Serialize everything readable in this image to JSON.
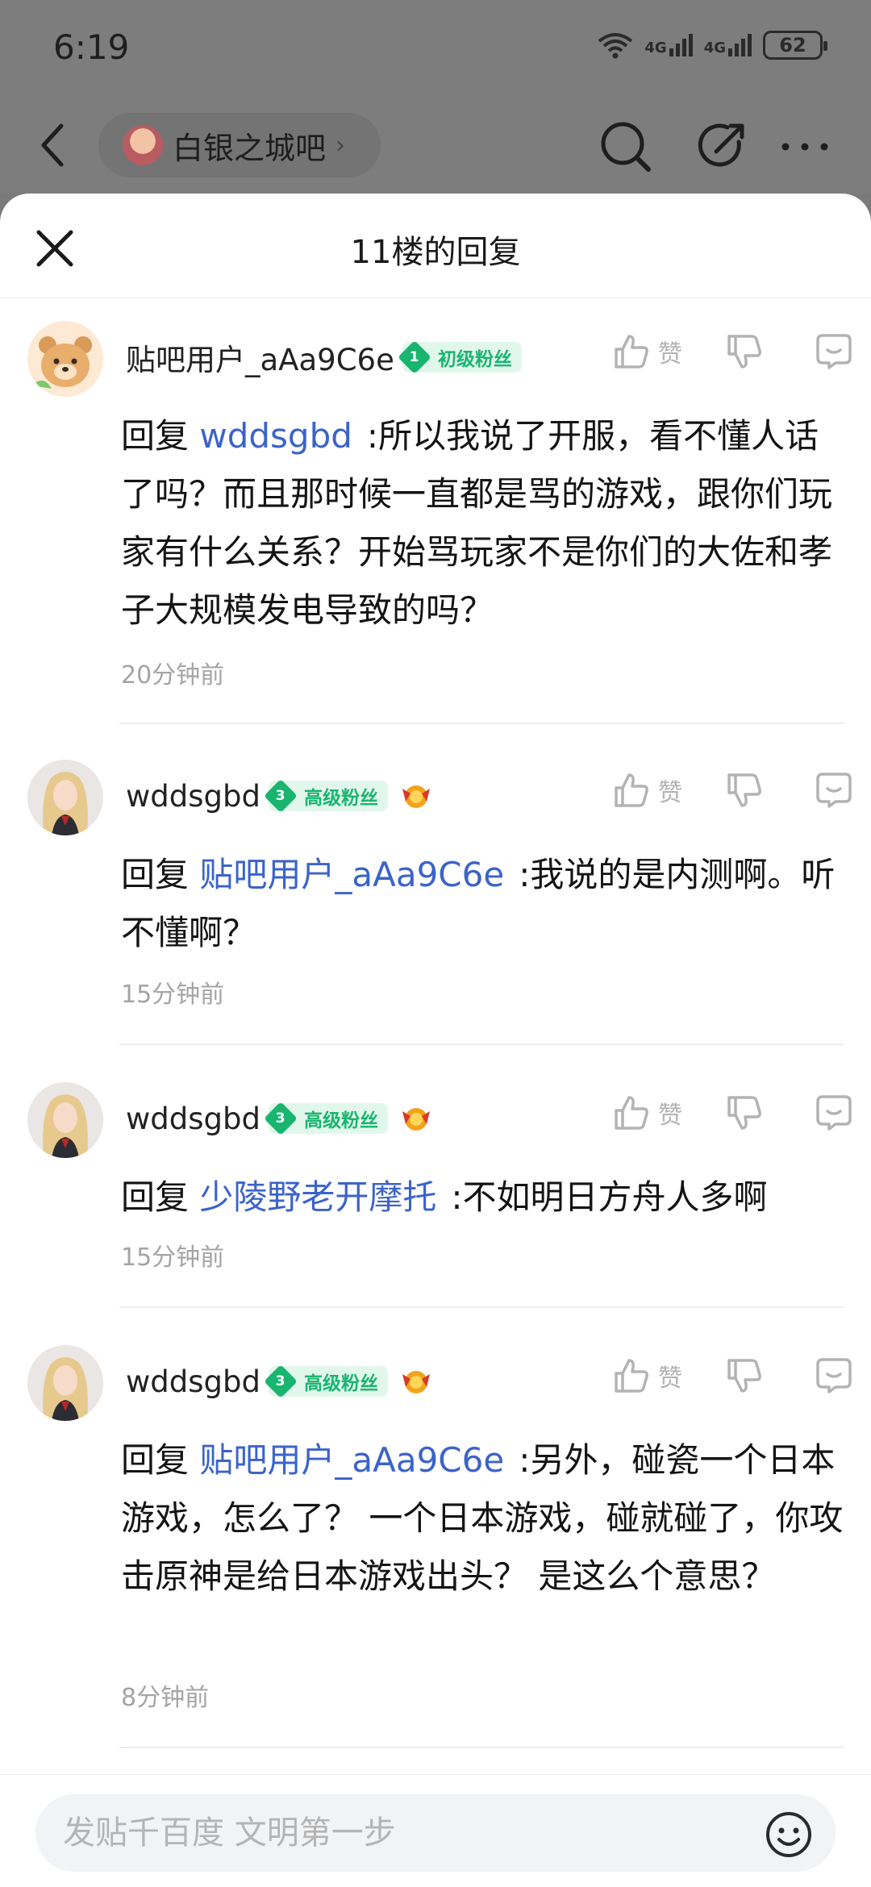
{
  "status": {
    "time": "6:19",
    "network1": "4G",
    "network2": "4G",
    "battery": "62"
  },
  "nav": {
    "forum_name": "白银之城吧",
    "chevron": "›"
  },
  "sheet": {
    "title": "11楼的回复"
  },
  "reply_prefix": "回复",
  "like_label": "赞",
  "replies": [
    {
      "username": "贴吧用户_aAa9C6e",
      "fan_level": "1",
      "fan_label": "初级粉丝",
      "mention": "wddsgbd",
      "text": ":所以我说了开服，看不懂人话了吗？而且那时候一直都是骂的游戏，跟你们玩家有什么关系？开始骂玩家不是你们的大佐和孝子大规模发电导致的吗？",
      "time": "20分钟前"
    },
    {
      "username": "wddsgbd",
      "fan_level": "3",
      "fan_label": "高级粉丝",
      "mention": "贴吧用户_aAa9C6e",
      "text": ":我说的是内测啊。听不懂啊？",
      "time": "15分钟前"
    },
    {
      "username": "wddsgbd",
      "fan_level": "3",
      "fan_label": "高级粉丝",
      "mention": "少陵野老开摩托",
      "text": ":不如明日方舟人多啊",
      "time": "15分钟前"
    },
    {
      "username": "wddsgbd",
      "fan_level": "3",
      "fan_label": "高级粉丝",
      "mention": "贴吧用户_aAa9C6e",
      "text": ":另外，碰瓷一个日本游戏，怎么了？ 一个日本游戏，碰就碰了，你攻击原神是给日本游戏出头？ 是这么个意思？",
      "time": "8分钟前"
    }
  ],
  "composer": {
    "placeholder": "发贴千百度 文明第一步"
  },
  "colors": {
    "mention": "#3b63c9",
    "fan_green": "#19b56f",
    "muted": "#a4a4a4"
  }
}
